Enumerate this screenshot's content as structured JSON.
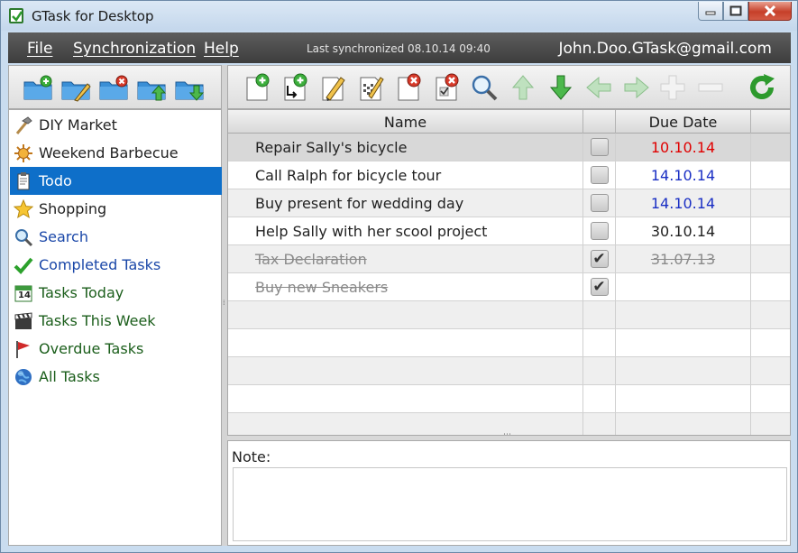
{
  "window": {
    "title": "GTask for Desktop"
  },
  "menu": {
    "items": [
      "File",
      "Synchronization",
      "Help"
    ],
    "sync_status": "Last synchronized 08.10.14 09:40",
    "account": "John.Doo.GTask@gmail.com"
  },
  "sidebar": {
    "items": [
      {
        "label": "DIY Market",
        "icon": "hammer-icon"
      },
      {
        "label": "Weekend Barbecue",
        "icon": "sun-icon"
      },
      {
        "label": "Todo",
        "icon": "notepad-icon"
      },
      {
        "label": "Shopping",
        "icon": "star-icon"
      },
      {
        "label": "Search",
        "icon": "magnifier-icon"
      },
      {
        "label": "Completed Tasks",
        "icon": "checkmark-icon"
      },
      {
        "label": "Tasks Today",
        "icon": "calendar-icon"
      },
      {
        "label": "Tasks This Week",
        "icon": "clapperboard-icon"
      },
      {
        "label": "Overdue Tasks",
        "icon": "flag-icon"
      },
      {
        "label": "All Tasks",
        "icon": "globe-icon"
      }
    ],
    "selected": "Todo",
    "calendar_day": "14"
  },
  "table": {
    "columns": [
      "Name",
      "",
      "Due Date"
    ],
    "rows": [
      {
        "name": "Repair Sally's bicycle",
        "done": false,
        "due": "10.10.14",
        "due_color": "#e00000"
      },
      {
        "name": "Call Ralph for bicycle tour",
        "done": false,
        "due": "14.10.14",
        "due_color": "#1a2fc4"
      },
      {
        "name": "Buy present for wedding day",
        "done": false,
        "due": "14.10.14",
        "due_color": "#1a2fc4"
      },
      {
        "name": "Help Sally with her scool project",
        "done": false,
        "due": "30.10.14",
        "due_color": "#222222"
      },
      {
        "name": "Tax Declaration",
        "done": true,
        "due": "31.07.13",
        "due_color": "#8a8a8a"
      },
      {
        "name": "Buy new Sneakers",
        "done": true,
        "due": "",
        "due_color": "#8a8a8a"
      }
    ]
  },
  "notes": {
    "label": "Note:",
    "value": ""
  },
  "colors": {
    "accent": "#0e6fc9",
    "menubar": "#4a4a4a",
    "overdue": "#e00000",
    "upcoming": "#1a2fc4"
  }
}
